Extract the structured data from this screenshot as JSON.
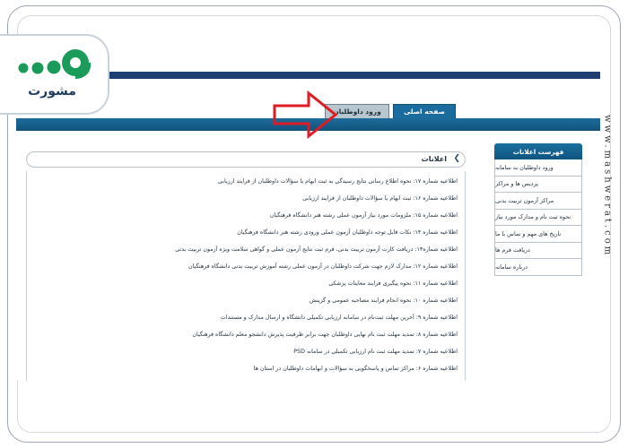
{
  "logo": {
    "wordmark": "مشورت"
  },
  "side_url": "www.mashwerat.com",
  "tabs": {
    "home": "صفحه اصلی",
    "login": "ورود داوطلبان"
  },
  "notices": {
    "title": "اعلانات",
    "items": [
      "اطلاعیه شماره ۱۷: نحوه اطلاع رسانی نتایج رسیدگی به ثبت ابهام یا سؤالات داوطلبان از فرایند ارزیابی",
      "اطلاعیه شماره ۱۶: ثبت ابهام یا سؤالات داوطلبان از فرایند ارزیابی",
      "اطلاعیه شماره ۱۵: ملزومات مورد نیاز آزمون عملی رشته هنر دانشگاه فرهنگیان",
      "اطلاعیه شماره ۱۴: نکات قابل توجه داوطلبان آزمون عملی ورودی رشته هنر دانشگاه فرهنگیان",
      "اطلاعیه شماره۱۳: دریافت کارت آزمون تربیت بدنی، فرم ثبت نتایج آزمون عملی و گواهی سلامت ویژه آزمون تربیت بدنی",
      "اطلاعیه شماره ۱۲: مدارک لازم جهت شرکت داوطلبان در آزمون عملی رشته آموزش تربیت بدنی دانشگاه فرهنگیان",
      "اطلاعیه شماره ۱۱: نحوه پیگیری فرایند معاینات پزشکی",
      "اطلاعیه شماره ۱۰: نحوه انجام فرایند مصاحبه عمومی و گزینش",
      "اطلاعیه شماره ۹: آخرین مهلت ثبت‌نام در سامانه ارزیابی تکمیلی دانشگاه و ارسال مدارک و مستندات",
      "اطلاعیه شماره ۸: تمدید مهلت ثبت نام نهایی داوطلبان جهت برابر ظرفیت پذیرش دانشجو معلم دانشگاه فرهنگیان",
      "اطلاعیه شماره ۷: تمدید مهلت ثبت نام ارزیابی تکمیلی در سامانه PSD",
      "اطلاعیه شماره ۶: مراکز تماس و پاسخگویی به سؤالات و ابهامات داوطلبان در استان ها"
    ]
  },
  "sidebar": {
    "title": "فهرست اعلانات",
    "items": [
      "ورود داوطلبان به سامانه",
      "پردیس ها و مراکز",
      "مراکز آزمون تربیت بدنی",
      "نحوه ثبت نام و مدارک مورد نیاز",
      "تاریخ های مهم و تماس با ما",
      "دریافت فرم ها",
      "درباره سامانه"
    ]
  },
  "colors": {
    "accent": "#1a6b9e",
    "navy": "#1f3f73",
    "arrow": "#e01b24",
    "logo_green": "#1a9b5a"
  },
  "icons": {
    "notices_chevron": "chevron-left-icon",
    "annotation": "arrow-right-icon"
  }
}
